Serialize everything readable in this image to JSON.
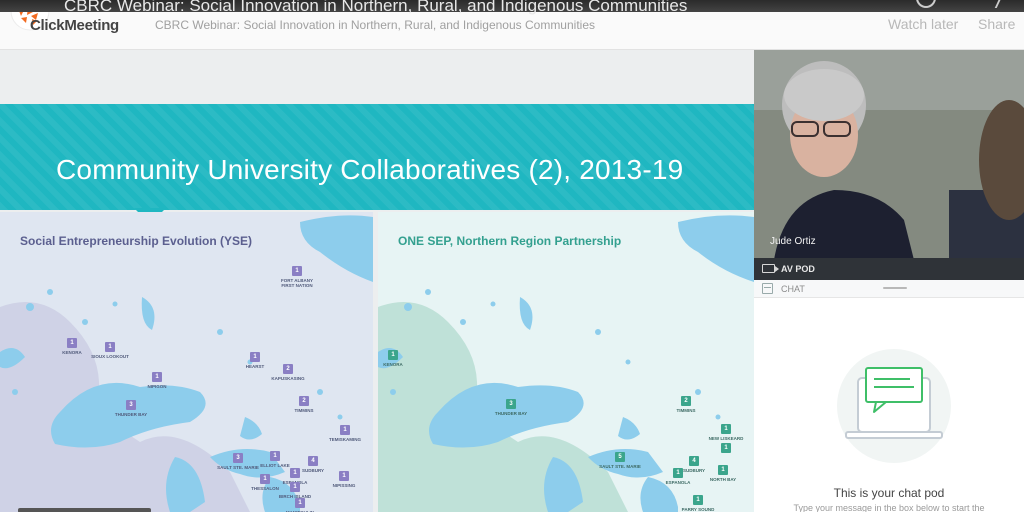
{
  "youtube": {
    "title": "CBRC Webinar: Social Innovation in Northern, Rural, and Indigenous Communities",
    "watch_later_label": "Watch later",
    "share_label": "Share"
  },
  "header": {
    "logo_text": "ClickMeeting",
    "meeting_title": "CBRC Webinar: Social Innovation in Northern, Rural, and Indigenous Communities"
  },
  "slide": {
    "title": "Community University Collaboratives (2), 2013-19",
    "band_color": "#1fb7c1",
    "left_map": {
      "title": "Social Entrepreneurship Evolution (YSE)",
      "markers": [
        {
          "count": "1",
          "label": "FORT ALBANY FIRST NATION"
        },
        {
          "count": "1",
          "label": "KENORA"
        },
        {
          "count": "1",
          "label": "SIOUX LOOKOUT"
        },
        {
          "count": "1",
          "label": "HEARST"
        },
        {
          "count": "2",
          "label": "KAPUSKASING"
        },
        {
          "count": "1",
          "label": "NIPIGON"
        },
        {
          "count": "2",
          "label": "TIMMINS"
        },
        {
          "count": "3",
          "label": "THUNDER BAY"
        },
        {
          "count": "1",
          "label": "TEMISKAMING"
        },
        {
          "count": "1",
          "label": "ELLIOT LAKE"
        },
        {
          "count": "3",
          "label": "SAULT STE. MARIE"
        },
        {
          "count": "4",
          "label": "SUDBURY"
        },
        {
          "count": "1",
          "label": "ESPANOLA"
        },
        {
          "count": "1",
          "label": "THESSALON"
        },
        {
          "count": "1",
          "label": "BIRCH ISLAND"
        },
        {
          "count": "1",
          "label": "NIPISSING"
        },
        {
          "count": "1",
          "label": "MANITOULIN ISLAND"
        }
      ]
    },
    "right_map": {
      "title": "ONE SEP, Northern Region Partnership",
      "markers": [
        {
          "count": "1",
          "label": "KENORA"
        },
        {
          "count": "3",
          "label": "THUNDER BAY"
        },
        {
          "count": "2",
          "label": "TIMMINS"
        },
        {
          "count": "1",
          "label": "NEW LISKEARD"
        },
        {
          "count": "1",
          "label": ""
        },
        {
          "count": "5",
          "label": "SAULT STE. MARIE"
        },
        {
          "count": "4",
          "label": "SUDBURY"
        },
        {
          "count": "1",
          "label": "ESPANOLA"
        },
        {
          "count": "1",
          "label": "NORTH BAY"
        },
        {
          "count": "1",
          "label": "PARRY SOUND"
        }
      ]
    }
  },
  "video": {
    "speaker_name": "Jude Ortiz",
    "pod_label": "AV POD"
  },
  "chat": {
    "header_label": "CHAT",
    "empty_title": "This is your chat pod",
    "empty_subtitle": "Type your message in the box below to start the"
  }
}
